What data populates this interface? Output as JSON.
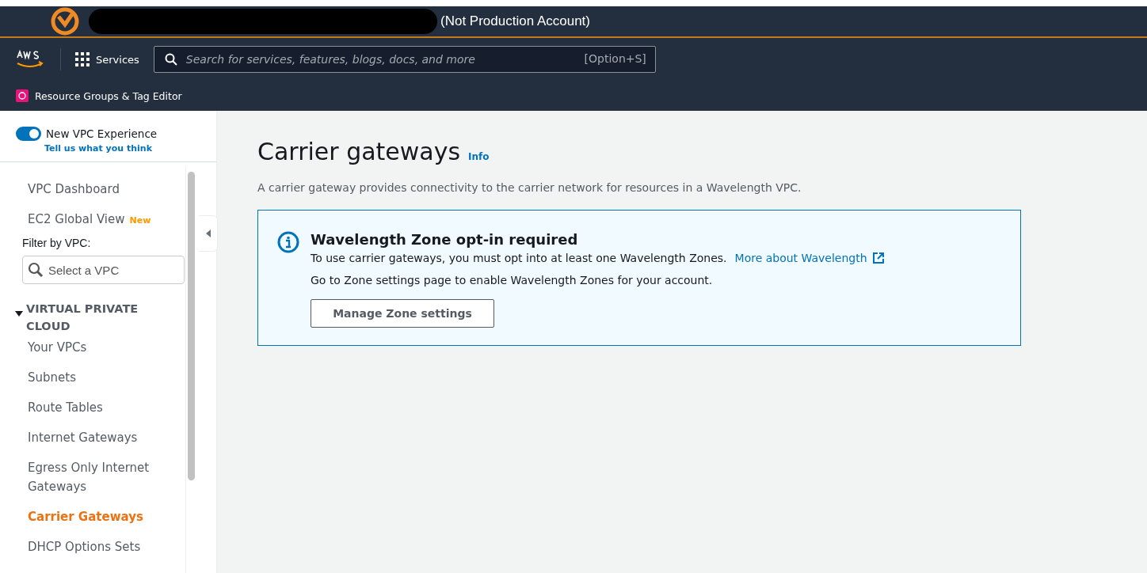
{
  "account_bar": {
    "label": "(Not Production Account)"
  },
  "top_nav": {
    "services": "Services",
    "search": {
      "placeholder": "Search for services, features, blogs, docs, and more",
      "shortcut": "[Option+S]"
    }
  },
  "favorites": [
    {
      "label": "Resource Groups & Tag Editor"
    }
  ],
  "sidebar": {
    "toggle": {
      "label": "New VPC Experience",
      "on": true,
      "link": "Tell us what you think"
    },
    "items": [
      {
        "label": "VPC Dashboard",
        "selected": false
      },
      {
        "label": "EC2 Global View",
        "badge": "New",
        "selected": false
      }
    ],
    "filter": {
      "label": "Filter by VPC:",
      "placeholder": "Select a VPC"
    },
    "section": {
      "title": "VIRTUAL PRIVATE CLOUD",
      "expanded": true,
      "items": [
        {
          "label": "Your VPCs",
          "selected": false
        },
        {
          "label": "Subnets",
          "selected": false
        },
        {
          "label": "Route Tables",
          "selected": false
        },
        {
          "label": "Internet Gateways",
          "selected": false
        },
        {
          "label": "Egress Only Internet Gateways",
          "selected": false
        },
        {
          "label": "Carrier Gateways",
          "selected": true
        },
        {
          "label": "DHCP Options Sets",
          "selected": false
        }
      ]
    }
  },
  "page": {
    "title": "Carrier gateways",
    "info": "Info",
    "description": "A carrier gateway provides connectivity to the carrier network for resources in a Wavelength VPC.",
    "alert": {
      "title": "Wavelength Zone opt-in required",
      "text": "To use carrier gateways, you must opt into at least one Wavelength Zones.",
      "link": "More about Wavelength",
      "text2": "Go to Zone settings page to enable Wavelength Zones for your account.",
      "button": "Manage Zone settings"
    }
  }
}
